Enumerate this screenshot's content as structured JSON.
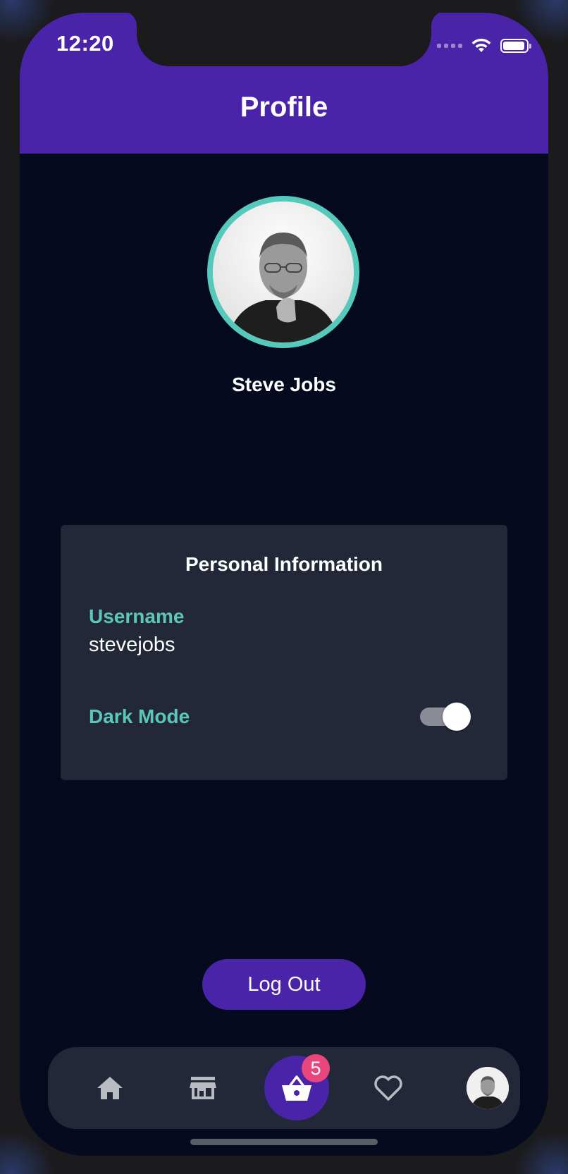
{
  "status_bar": {
    "time": "12:20",
    "battery_level": 0.95
  },
  "header": {
    "title": "Profile"
  },
  "profile": {
    "name": "Steve Jobs",
    "avatar_icon": "person-photo-icon"
  },
  "personal_info": {
    "title": "Personal Information",
    "username_label": "Username",
    "username_value": "stevejobs",
    "dark_mode_label": "Dark Mode",
    "dark_mode_enabled": true
  },
  "actions": {
    "logout_label": "Log Out"
  },
  "tab_bar": {
    "items": [
      {
        "name": "home",
        "icon": "home-icon"
      },
      {
        "name": "store",
        "icon": "store-icon"
      },
      {
        "name": "cart",
        "icon": "basket-icon",
        "badge": "5"
      },
      {
        "name": "favorites",
        "icon": "heart-icon"
      },
      {
        "name": "profile",
        "icon": "avatar-icon"
      }
    ]
  },
  "colors": {
    "header_bg": "#4a24a8",
    "screen_bg": "#050a1e",
    "card_bg": "#232839",
    "accent_teal": "#56c9bd",
    "badge_pink": "#e8467c",
    "icon_gray": "#b9bbc2"
  }
}
